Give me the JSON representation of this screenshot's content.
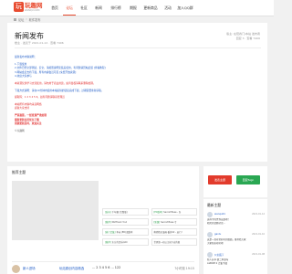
{
  "site": {
    "logo_mark": "玩",
    "logo_text": "玩趣网",
    "logo_sub": "WANQU.COM"
  },
  "nav": {
    "items": [
      "首页",
      "论坛",
      "社区",
      "新闻",
      "排行榜",
      "期报",
      "更新商品",
      "活动",
      "加入QQ群"
    ],
    "active_index": 1
  },
  "breadcrumb": [
    "论坛",
    "软件发布"
  ],
  "post": {
    "title": "新闻发布",
    "meta": "楼主 · 发表于 2021-01-12 · 查看 7406",
    "side_line1": "版主: 在阳春门/本站 发布者",
    "side_line2": "回复 3 · 查看 7406",
    "body": [
      {
        "text": "最新发布内容说明：",
        "style": "c-blue"
      },
      {
        "text": "",
        "style": "gap"
      },
      {
        "text": "1.下载使用",
        "style": "c-blue"
      },
      {
        "text": "2.文件已经全部测试，安全，请按照说明安装后使用，有问题请回帖反馈 [查看教程]",
        "style": "c-blue"
      },
      {
        "text": "3.网站会员支持下载，所有内容会员可见 [免费开放资源]",
        "style": "c-blue"
      },
      {
        "text": "4.欢迎大家参与",
        "style": "c-blue"
      },
      {
        "text": "",
        "style": "gap"
      },
      {
        "text": "本资源仅供学习交流使用，请勿用于商业用途，如有侵权请联系删除处理。",
        "style": "c-red"
      },
      {
        "text": "",
        "style": "gap"
      },
      {
        "text": "下载方式说明：请在10分钟内使用本站提供的链接完成下载，过期需要重新获取。",
        "style": "c-blue"
      },
      {
        "text": "",
        "style": "gap"
      },
      {
        "text": "提取码：1 2 3 4 5 6，如有问题请联系管理员",
        "style": "c-red"
      },
      {
        "text": "",
        "style": "gap"
      },
      {
        "text": "本站所有内容均来自网络",
        "style": "c-red"
      },
      {
        "text": "感谢大家支持",
        "style": "c-red"
      },
      {
        "text": "",
        "style": "gap"
      },
      {
        "text": "严禁盗链，一经发现严肃处理",
        "style": "c-red bold"
      },
      {
        "text": "最新更新会员优先下载",
        "style": "c-red bold"
      },
      {
        "text": "资源更新及时，欢迎关注",
        "style": "c-red bold"
      },
      {
        "text": "",
        "style": "gap"
      },
      {
        "text": "©玩趣网",
        "style": "c-gray"
      }
    ]
  },
  "related": {
    "title": "推荐主题",
    "items": [
      {
        "tag": "[发布]",
        "text": "千年魔 (完整版)"
      },
      {
        "tag": "[PC版本]",
        "text": "Secret Base - 冬"
      },
      {
        "tag": "[推荐]",
        "text": "NGThank You!"
      },
      {
        "tag": "[新版]",
        "text": "Secret Base 专"
      },
      {
        "tag": "[热门合集]",
        "text": "本末 (ED)双版本"
      },
      {
        "tag": "",
        "text": "像素精灵漫画·番外02 - 运行!"
      },
      {
        "tag": "[推荐]",
        "text": "东方的音乐QAC"
      },
      {
        "tag": "",
        "text": "世界第一初公主前下自的视"
      }
    ],
    "reply": {
      "user": "新人进场",
      "link": "玩站原创内容精选",
      "pages": "... 2 3 4 5 6 ... 122",
      "time": "7小时前 19:15"
    }
  },
  "actions": {
    "primary": "发表主题",
    "secondary": "回复Sign"
  },
  "topics": {
    "title": "最新主题",
    "items": [
      {
        "user": "wanqu01",
        "date": "2021-01-12",
        "lines": [
          "这样子的世界出发吧！",
          "相关的话题讨论..."
        ]
      },
      {
        "user": "ganlu",
        "date": "2021-01-10",
        "lines": [
          "这是一首非常好听的歌曲，推荐给大家",
          "大家快来听听吧"
        ]
      },
      {
        "user": "公主殿下",
        "date": "2021-01-08",
        "lines": [
          "新人分享·第二季发布",
          "ALBUM 2 合集下载"
        ]
      }
    ]
  }
}
